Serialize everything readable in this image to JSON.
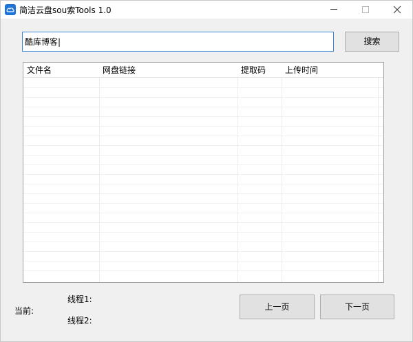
{
  "window": {
    "title": "简洁云盘sou索Tools 1.0",
    "icon": "cloud-icon",
    "controls": [
      "minimize-icon",
      "maximize-icon",
      "close-icon"
    ]
  },
  "search": {
    "value": "酷库博客|",
    "button_label": "搜索"
  },
  "table": {
    "columns": [
      "文件名",
      "网盘链接",
      "提取码",
      "上传时间"
    ],
    "rows": []
  },
  "status": {
    "current_label": "当前:",
    "thread1_label": "线程1:",
    "thread2_label": "线程2:"
  },
  "pager": {
    "prev_label": "上一页",
    "next_label": "下一页"
  },
  "colors": {
    "accent": "#3a86d8",
    "icon": "#1e73d8",
    "window_bg": "#f0f0f0"
  }
}
